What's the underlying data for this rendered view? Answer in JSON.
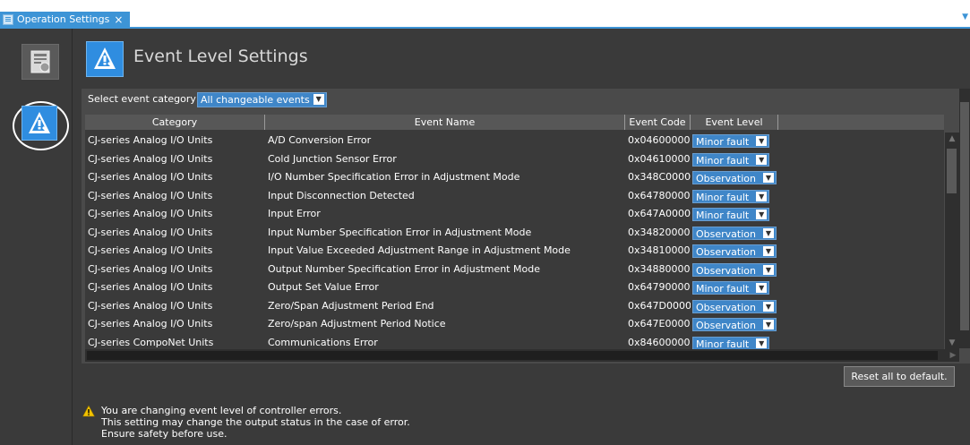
{
  "tab": {
    "title": "Operation Settings",
    "close": "×"
  },
  "page": {
    "title": "Event Level Settings"
  },
  "filter": {
    "label": "Select event category",
    "value": "All changeable events"
  },
  "table": {
    "headers": [
      "Category",
      "Event Name",
      "Event Code",
      "Event Level"
    ],
    "rows": [
      {
        "category": "CJ-series Analog I/O Units",
        "name": "A/D Conversion Error",
        "code": "0x04600000",
        "level": "Minor fault"
      },
      {
        "category": "CJ-series Analog I/O Units",
        "name": "Cold Junction Sensor Error",
        "code": "0x04610000",
        "level": "Minor fault"
      },
      {
        "category": "CJ-series Analog I/O Units",
        "name": "I/O Number Specification Error in Adjustment Mode",
        "code": "0x348C0000",
        "level": "Observation"
      },
      {
        "category": "CJ-series Analog I/O Units",
        "name": "Input Disconnection Detected",
        "code": "0x64780000",
        "level": "Minor fault"
      },
      {
        "category": "CJ-series Analog I/O Units",
        "name": "Input Error",
        "code": "0x647A0000",
        "level": "Minor fault"
      },
      {
        "category": "CJ-series Analog I/O Units",
        "name": "Input Number Specification Error in Adjustment Mode",
        "code": "0x34820000",
        "level": "Observation"
      },
      {
        "category": "CJ-series Analog I/O Units",
        "name": "Input Value Exceeded Adjustment Range in Adjustment Mode",
        "code": "0x34810000",
        "level": "Observation"
      },
      {
        "category": "CJ-series Analog I/O Units",
        "name": "Output Number Specification Error in Adjustment Mode",
        "code": "0x34880000",
        "level": "Observation"
      },
      {
        "category": "CJ-series Analog I/O Units",
        "name": "Output Set Value Error",
        "code": "0x64790000",
        "level": "Minor fault"
      },
      {
        "category": "CJ-series Analog I/O Units",
        "name": "Zero/Span Adjustment Period End",
        "code": "0x647D0000",
        "level": "Observation"
      },
      {
        "category": "CJ-series Analog I/O Units",
        "name": "Zero/span Adjustment Period Notice",
        "code": "0x647E0000",
        "level": "Observation"
      },
      {
        "category": "CJ-series CompoNet Units",
        "name": "Communications Error",
        "code": "0x84600000",
        "level": "Minor fault"
      }
    ]
  },
  "reset": {
    "label": "Reset all to default."
  },
  "warning": {
    "text": "You are changing event level of controller errors.\nThis setting may change the output status in the case of error.\nEnsure safety before use."
  },
  "colors": {
    "accent": "#3d94d6",
    "background": "#3a3a3a",
    "selection": "#3f86c8"
  }
}
